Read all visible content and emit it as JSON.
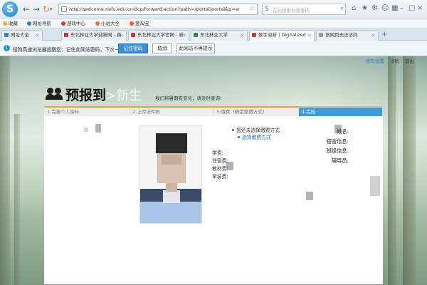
{
  "browser": {
    "logo": "S",
    "url": "http://welcome.nefu.edu.cn/dcp/forward.action?path=/portal/portal&p=enrollregisteHomePage&t",
    "search_placeholder": "在此搜索你想要的",
    "favorites": [
      "收藏",
      "网址导航",
      "游戏中心",
      "小说大全",
      "爱淘宝"
    ],
    "tabs": [
      {
        "label": "网址大全",
        "active": false
      },
      {
        "label": "东北林业大学迎新网 - 新",
        "active": false
      },
      {
        "label": "东北林业大学官网 - 新",
        "active": false
      },
      {
        "label": "东北林业大学",
        "active": false
      },
      {
        "label": "数字迎新 | Digitalized",
        "active": true
      },
      {
        "label": "该网页无法访问",
        "active": false
      }
    ]
  },
  "password_bar": {
    "message": "搜狗高速浏览器提醒您：记住此网站密码，下次一键登录!",
    "buttons": [
      "记住密码",
      "取消",
      "此网站不再提示"
    ]
  },
  "header": {
    "links": [
      "密码设置",
      "注销",
      "退出"
    ],
    "title_left": "预报到",
    "title_right": ">新生",
    "slogan": "我们将暑期有变化，请及时查询!"
  },
  "steps": [
    "1.完善个人资料",
    "2.上传证件照",
    "3.缴费（确定缴费方式）",
    "4.完成"
  ],
  "student": {
    "labels": [
      "学费:",
      "住宿费:",
      "教材费:",
      "军装费:"
    ],
    "status_lines": [
      "您还未选择缴费方式",
      "选择缴费方式"
    ],
    "info_labels": [
      "姓名:",
      "宿舍信息:",
      "班级信息:",
      "辅导员:"
    ]
  },
  "colors": {
    "active_step": "#3e9bd6",
    "done_step_border": "#f0a030",
    "link": "#1e6fc0"
  }
}
